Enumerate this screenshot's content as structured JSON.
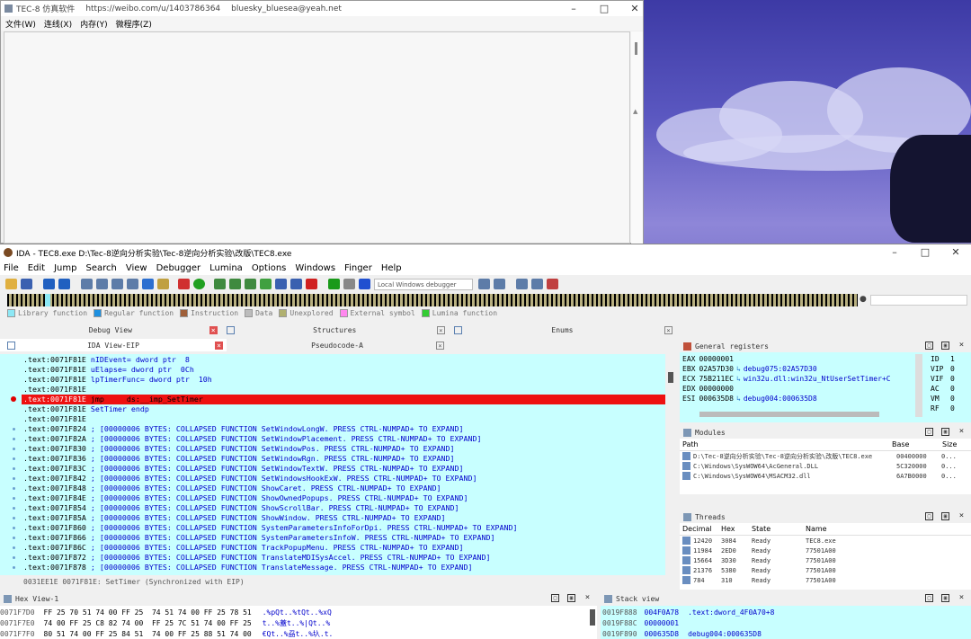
{
  "tec": {
    "title": "TEC-8 仿真软件",
    "url": "https://weibo.com/u/1403786364",
    "email": "bluesky_bluesea@yeah.net",
    "menu": [
      "文件(W)",
      "连线(X)",
      "内存(Y)",
      "微程序(Z)"
    ]
  },
  "ida": {
    "title": "IDA - TEC8.exe D:\\Tec-8逆向分析实验\\Tec-8逆向分析实验\\改版\\TEC8.exe",
    "menu": [
      "File",
      "Edit",
      "Jump",
      "Search",
      "View",
      "Debugger",
      "Lumina",
      "Options",
      "Windows",
      "Finger",
      "Help"
    ],
    "debugger_select": "Local Windows debugger",
    "legend": [
      {
        "label": "Library function",
        "color": "#8de8f5"
      },
      {
        "label": "Regular function",
        "color": "#1e90e0"
      },
      {
        "label": "Instruction",
        "color": "#a0603a"
      },
      {
        "label": "Data",
        "color": "#bcbcbc"
      },
      {
        "label": "Unexplored",
        "color": "#b0b070"
      },
      {
        "label": "External symbol",
        "color": "#ff88ee"
      },
      {
        "label": "Lumina function",
        "color": "#33cc33"
      }
    ],
    "tabs_row1": [
      "Debug View",
      "Structures",
      "Enums"
    ],
    "tabs_row2": [
      "IDA View-EIP",
      "Pseudocode-A"
    ],
    "disasm": [
      {
        "addr": ".text:0071F81E",
        "body": " nIDEvent= dword ptr  8"
      },
      {
        "addr": ".text:0071F81E",
        "body": " uElapse= dword ptr  0Ch"
      },
      {
        "addr": ".text:0071F81E",
        "body": " lpTimerFunc= dword ptr  10h"
      },
      {
        "addr": ".text:0071F81E",
        "body": ""
      },
      {
        "addr": ".text:0071F81E",
        "body": " jmp     ds:__imp_SetTimer"
      },
      {
        "addr": ".text:0071F81E",
        "body": " SetTimer endp"
      },
      {
        "addr": ".text:0071F81E",
        "body": ""
      },
      {
        "addr": ".text:0071F824",
        "body": " ; [00000006 BYTES: COLLAPSED FUNCTION SetWindowLongW. PRESS CTRL-NUMPAD+ TO EXPAND]"
      },
      {
        "addr": ".text:0071F82A",
        "body": " ; [00000006 BYTES: COLLAPSED FUNCTION SetWindowPlacement. PRESS CTRL-NUMPAD+ TO EXPAND]"
      },
      {
        "addr": ".text:0071F830",
        "body": " ; [00000006 BYTES: COLLAPSED FUNCTION SetWindowPos. PRESS CTRL-NUMPAD+ TO EXPAND]"
      },
      {
        "addr": ".text:0071F836",
        "body": " ; [00000006 BYTES: COLLAPSED FUNCTION SetWindowRgn. PRESS CTRL-NUMPAD+ TO EXPAND]"
      },
      {
        "addr": ".text:0071F83C",
        "body": " ; [00000006 BYTES: COLLAPSED FUNCTION SetWindowTextW. PRESS CTRL-NUMPAD+ TO EXPAND]"
      },
      {
        "addr": ".text:0071F842",
        "body": " ; [00000006 BYTES: COLLAPSED FUNCTION SetWindowsHookExW. PRESS CTRL-NUMPAD+ TO EXPAND]"
      },
      {
        "addr": ".text:0071F848",
        "body": " ; [00000006 BYTES: COLLAPSED FUNCTION ShowCaret. PRESS CTRL-NUMPAD+ TO EXPAND]"
      },
      {
        "addr": ".text:0071F84E",
        "body": " ; [00000006 BYTES: COLLAPSED FUNCTION ShowOwnedPopups. PRESS CTRL-NUMPAD+ TO EXPAND]"
      },
      {
        "addr": ".text:0071F854",
        "body": " ; [00000006 BYTES: COLLAPSED FUNCTION ShowScrollBar. PRESS CTRL-NUMPAD+ TO EXPAND]"
      },
      {
        "addr": ".text:0071F85A",
        "body": " ; [00000006 BYTES: COLLAPSED FUNCTION ShowWindow. PRESS CTRL-NUMPAD+ TO EXPAND]"
      },
      {
        "addr": ".text:0071F860",
        "body": " ; [00000006 BYTES: COLLAPSED FUNCTION SystemParametersInfoForDpi. PRESS CTRL-NUMPAD+ TO EXPAND]"
      },
      {
        "addr": ".text:0071F866",
        "body": " ; [00000006 BYTES: COLLAPSED FUNCTION SystemParametersInfoW. PRESS CTRL-NUMPAD+ TO EXPAND]"
      },
      {
        "addr": ".text:0071F86C",
        "body": " ; [00000006 BYTES: COLLAPSED FUNCTION TrackPopupMenu. PRESS CTRL-NUMPAD+ TO EXPAND]"
      },
      {
        "addr": ".text:0071F872",
        "body": " ; [00000006 BYTES: COLLAPSED FUNCTION TranslateMDISysAccel. PRESS CTRL-NUMPAD+ TO EXPAND]"
      },
      {
        "addr": ".text:0071F878",
        "body": " ; [00000006 BYTES: COLLAPSED FUNCTION TranslateMessage. PRESS CTRL-NUMPAD+ TO EXPAND]"
      }
    ],
    "status_line": "0031EE1E 0071F81E: SetTimer (Synchronized with EIP)",
    "registers": {
      "title": "General registers",
      "rows": [
        {
          "name": "EAX",
          "val": "00000001",
          "info": ""
        },
        {
          "name": "EBX",
          "val": "02A57D30",
          "info": "debug075:02A57D30"
        },
        {
          "name": "ECX",
          "val": "75B211EC",
          "info": "win32u.dll:win32u_NtUserSetTimer+C"
        },
        {
          "name": "EDX",
          "val": "00000000",
          "info": ""
        },
        {
          "name": "ESI",
          "val": "000635D8",
          "info": "debug004:000635D8"
        }
      ],
      "flags": [
        {
          "n": "ID",
          "v": "1"
        },
        {
          "n": "VIP",
          "v": "0"
        },
        {
          "n": "VIF",
          "v": "0"
        },
        {
          "n": "AC",
          "v": "0"
        },
        {
          "n": "VM",
          "v": "0"
        },
        {
          "n": "RF",
          "v": "0"
        }
      ]
    },
    "modules": {
      "title": "Modules",
      "cols": [
        "Path",
        "Base",
        "Size"
      ],
      "rows": [
        {
          "path": "D:\\Tec-8逆向分析实验\\Tec-8逆向分析实验\\改版\\TEC8.exe",
          "base": "00400000",
          "size": "0..."
        },
        {
          "path": "C:\\Windows\\SysWOW64\\AcGeneral.DLL",
          "base": "5C320000",
          "size": "0..."
        },
        {
          "path": "C:\\Windows\\SysWOW64\\MSACM32.dll",
          "base": "6A7B0000",
          "size": "0..."
        }
      ]
    },
    "threads": {
      "title": "Threads",
      "cols": [
        "Decimal",
        "Hex",
        "State",
        "Name"
      ],
      "rows": [
        {
          "dec": "12420",
          "hex": "3084",
          "state": "Ready",
          "name": "TEC8.exe"
        },
        {
          "dec": "11984",
          "hex": "2ED0",
          "state": "Ready",
          "name": "77501A00"
        },
        {
          "dec": "15664",
          "hex": "3D30",
          "state": "Ready",
          "name": "77501A00"
        },
        {
          "dec": "21376",
          "hex": "5380",
          "state": "Ready",
          "name": "77501A00"
        },
        {
          "dec": "784",
          "hex": "310",
          "state": "Ready",
          "name": "77501A00"
        }
      ]
    },
    "hex_view": {
      "title": "Hex View-1",
      "rows": [
        {
          "addr": "0071F7D0",
          "bytes": "FF 25 70 51 74 00 FF 25  74 51 74 00 FF 25 78 51",
          "ascii": ".%pQt..%tQt..%xQ"
        },
        {
          "addr": "0071F7E0",
          "bytes": "74 00 FF 25 C8 82 74 00  FF 25 7C 51 74 00 FF 25",
          "ascii": "t..%蓋t..%|Qt..%"
        },
        {
          "addr": "0071F7F0",
          "bytes": "80 51 74 00 FF 25 84 51  74 00 FF 25 88 51 74 00",
          "ascii": "€Qt..%刕t..%圦.t."
        }
      ]
    },
    "stack_view": {
      "title": "Stack view",
      "rows": [
        {
          "addr": "0019F888",
          "val": "004F0A78",
          "info": ".text:dword_4F0A70+8"
        },
        {
          "addr": "0019F88C",
          "val": "00000001",
          "info": ""
        },
        {
          "addr": "0019F890",
          "val": "000635D8",
          "info": "debug004:000635D8"
        }
      ]
    }
  },
  "colors": {
    "disasm_bg": "#c8ffff",
    "highlight": "#ee1111",
    "code_blue": "#0000cc"
  }
}
